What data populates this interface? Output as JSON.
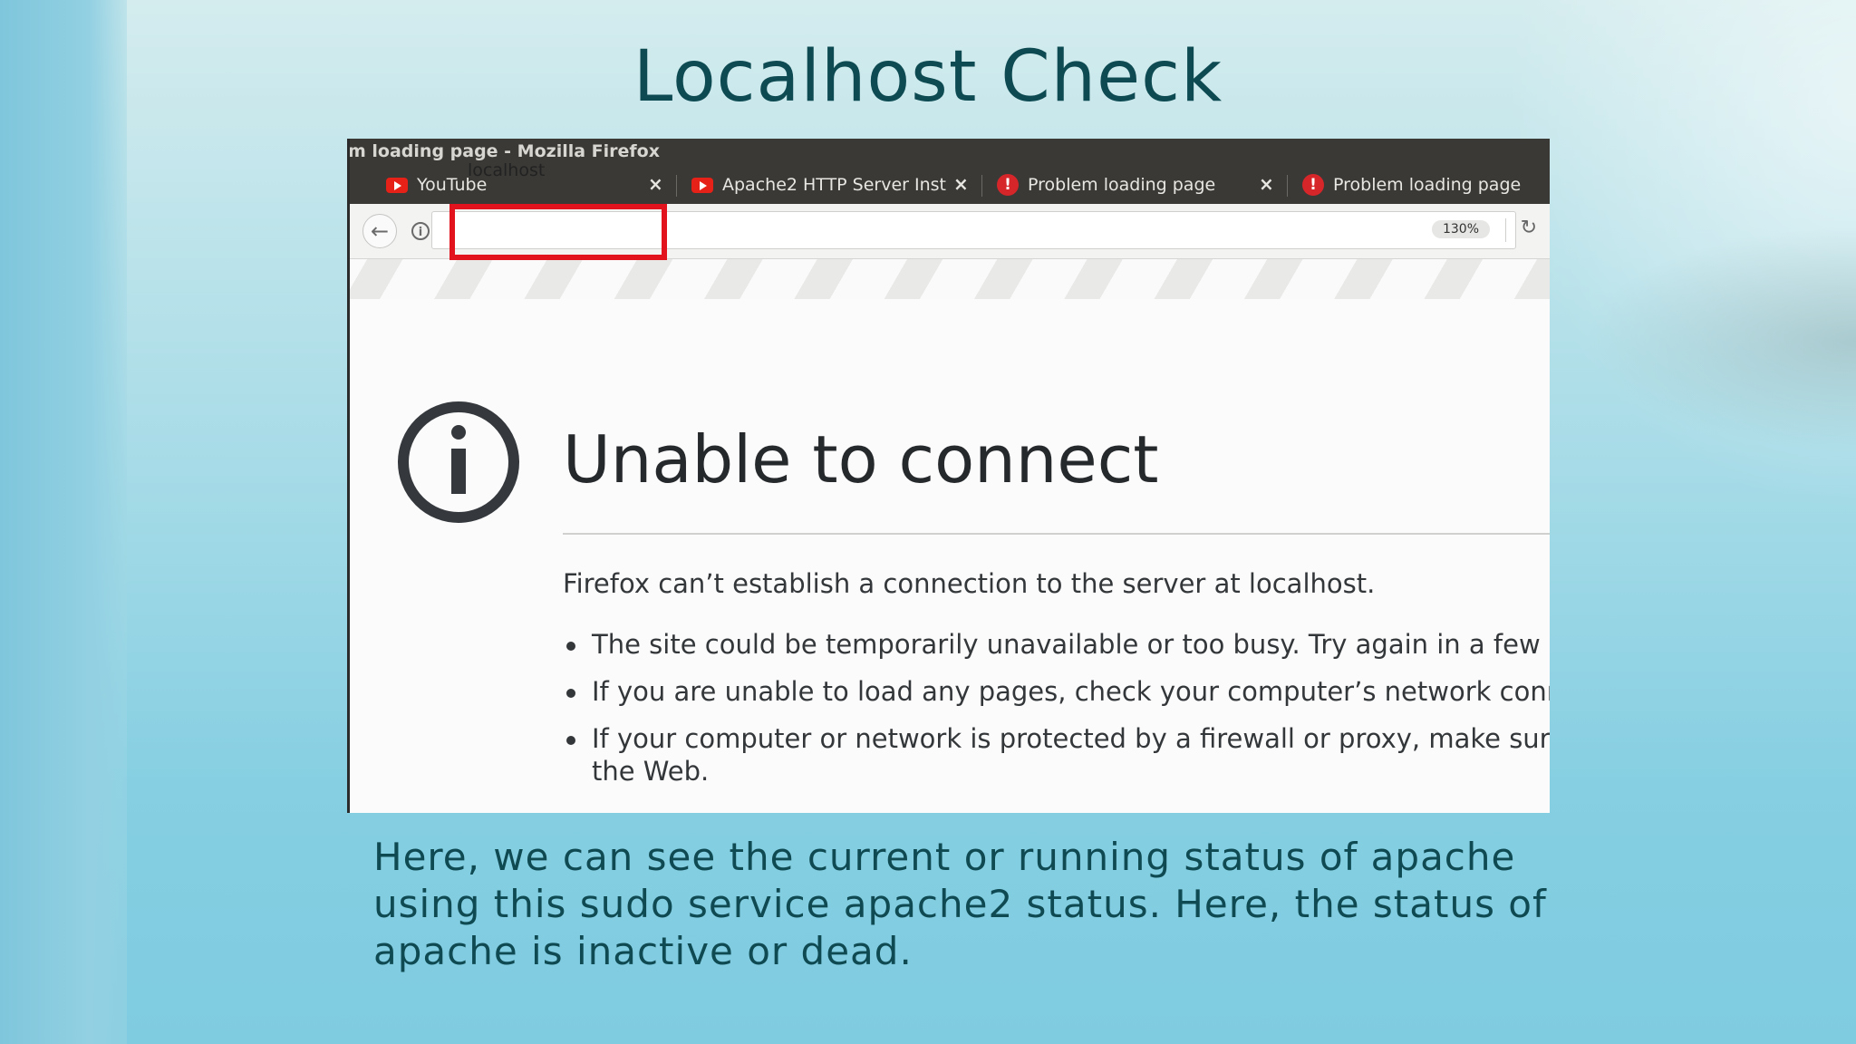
{
  "slide": {
    "title": "Localhost Check",
    "caption": "Here, we can see the current or running status of apache using this sudo service apache2 status. Here, the status of apache is inactive or dead."
  },
  "browser": {
    "window_title": "m loading page - Mozilla Firefox",
    "tabs": [
      {
        "label": "YouTube",
        "icon": "youtube-icon"
      },
      {
        "label": "Apache2 HTTP Server Inst",
        "icon": "youtube-icon"
      },
      {
        "label": "Problem loading page",
        "icon": "error-icon"
      },
      {
        "label": "Problem loading page",
        "icon": "error-icon"
      }
    ],
    "url": "localhost",
    "zoom": "130%",
    "highlight_color": "#e2131c"
  },
  "error_page": {
    "title": "Unable to connect",
    "description": "Firefox can’t establish a connection to the server at localhost.",
    "bullets": [
      "The site could be temporarily unavailable or too busy. Try again in a few m",
      "If you are unable to load any pages, check your computer’s network conne",
      "If your computer or network is protected by a firewall or proxy, make sur",
      "the Web."
    ]
  },
  "colors": {
    "title": "#0e4a52",
    "tab_bar": "#3a3936",
    "error_text": "#26292c"
  }
}
